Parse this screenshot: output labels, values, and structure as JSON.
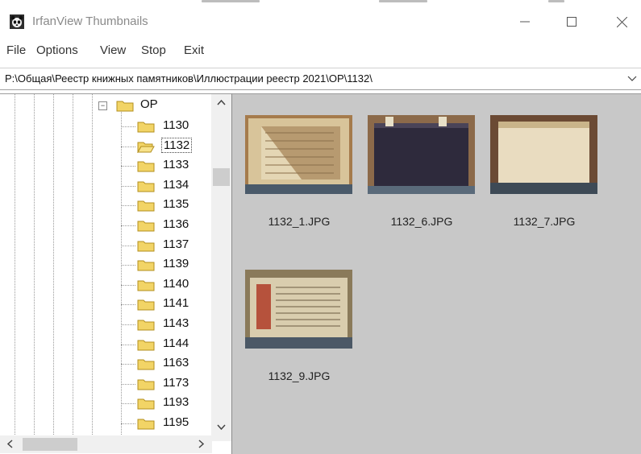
{
  "window": {
    "title": "IrfanView Thumbnails"
  },
  "menu": {
    "items": [
      {
        "id": "file",
        "label": "File"
      },
      {
        "id": "options",
        "label": "Options"
      },
      {
        "id": "view",
        "label": "View"
      },
      {
        "id": "stop",
        "label": "Stop"
      },
      {
        "id": "exit",
        "label": "Exit"
      }
    ]
  },
  "path": {
    "value": "P:\\Общая\\Реестр книжных памятников\\Иллюстрации реестр 2021\\ОР\\1132\\"
  },
  "tree": {
    "parent_label": "ОР",
    "selected": "1132",
    "folders": [
      "1130",
      "1132",
      "1133",
      "1134",
      "1135",
      "1136",
      "1137",
      "1139",
      "1140",
      "1141",
      "1143",
      "1144",
      "1163",
      "1173",
      "1193",
      "1195"
    ]
  },
  "thumbnails": [
    {
      "name": "1132_1.JPG",
      "variant": "open-book"
    },
    {
      "name": "1132_6.JPG",
      "variant": "dark-cover"
    },
    {
      "name": "1132_7.JPG",
      "variant": "pale-cover"
    },
    {
      "name": "1132_9.JPG",
      "variant": "open-book-red"
    }
  ],
  "icons": {
    "app": "irfanview-panda-icon",
    "folder": "folder-icon",
    "open_folder": "open-folder-icon",
    "minimize": "minimize-icon",
    "maximize": "maximize-icon",
    "close": "close-icon",
    "dropdown": "chevron-down-icon"
  },
  "colors": {
    "folder": "#f2d466",
    "folder_edge": "#b38f1f",
    "pane_background": "#c8c8c8",
    "scrollbar_thumb": "#cdcdcd"
  }
}
